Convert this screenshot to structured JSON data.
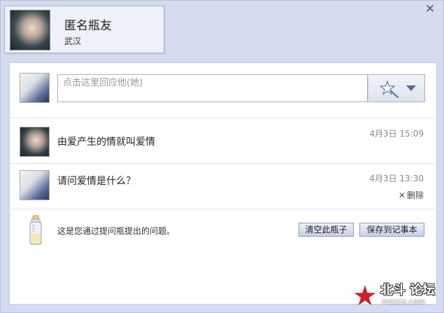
{
  "window": {
    "close_symbol": "✕"
  },
  "profile": {
    "name": "匿名瓶友",
    "city": "武汉"
  },
  "reply": {
    "placeholder": "点击这里回应他(她)",
    "emoji_icon": "magic-wand-icon"
  },
  "messages": [
    {
      "text": "由爱产生的情就叫爱情",
      "time": "4月3日 15:09"
    },
    {
      "text": "请问爱情是什么？",
      "time": "4月3日 13:30",
      "delete_label": "删除",
      "delete_symbol": "✕"
    }
  ],
  "footer": {
    "text": "这是您通过提问瓶提出的问题。",
    "clear_button": "清空此瓶子",
    "save_button": "保存到记事本"
  },
  "watermark": {
    "brand": "北斗 论坛",
    "url": "mzxzx.com"
  },
  "colors": {
    "accent": "#d6dcef",
    "button": "#c8d0e6",
    "watermark_star": "#c8242b"
  }
}
